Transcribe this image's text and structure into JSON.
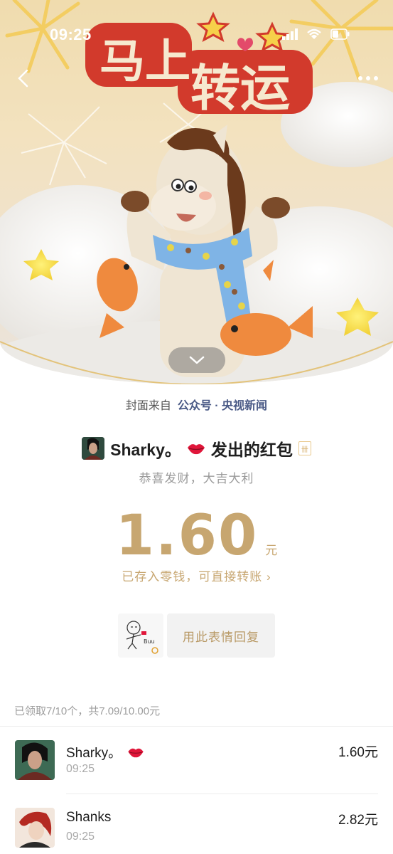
{
  "status_bar": {
    "time": "09:25"
  },
  "cover": {
    "title_line1": "马上",
    "title_line2": "转运"
  },
  "cover_source": {
    "prefix": "封面来自",
    "source": "公众号 · 央视新闻"
  },
  "sender": {
    "name": "Sharky。",
    "suffix": "发出的红包",
    "tag_icon_text": "卌"
  },
  "blessing": "恭喜发财，大吉大利",
  "amount": {
    "value": "1.60",
    "unit": "元"
  },
  "saved_link": "已存入零钱，可直接转账 ›",
  "sticker": {
    "text": "Buu"
  },
  "reply_button": "用此表情回复",
  "summary": "已领取7/10个，共7.09/10.00元",
  "records": [
    {
      "name": "Sharky。",
      "time": "09:25",
      "amount": "1.60元",
      "has_lips": true
    },
    {
      "name": "Shanks",
      "time": "09:25",
      "amount": "2.82元",
      "has_lips": false
    }
  ],
  "colors": {
    "gold": "#c7a670",
    "link_blue": "#4a5a86",
    "muted": "#9a9a9a",
    "lips_red": "#e0163a"
  }
}
